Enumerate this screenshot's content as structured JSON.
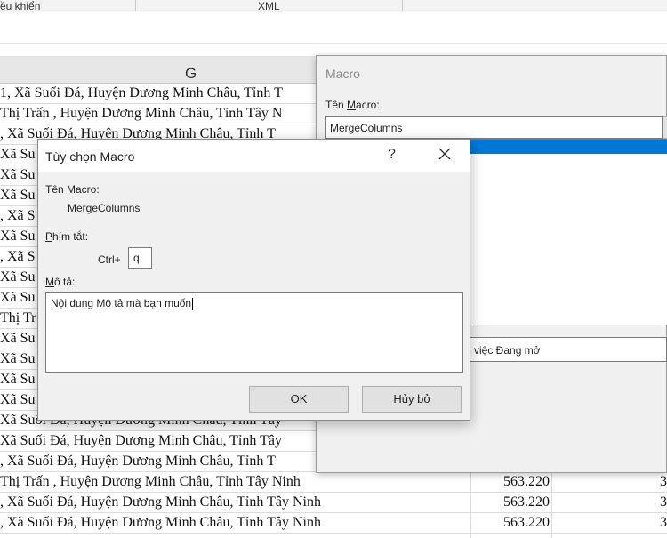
{
  "ribbon": {
    "group1": "ều khiển",
    "group2": "XML"
  },
  "sheet": {
    "column_header": "G",
    "rows": [
      {
        "address": "1, Xã Suối Đá, Huyện Dương Minh Châu, Tỉnh T",
        "num1": "",
        "num2": ""
      },
      {
        "address": "Thị Trấn , Huyện Dương Minh Châu, Tỉnh Tây N",
        "num1": "",
        "num2": ""
      },
      {
        "address": ", Xã Suối Đá, Huyện Dương Minh Châu, Tỉnh T",
        "num1": "",
        "num2": ""
      },
      {
        "address": "Xã Su",
        "num1": "",
        "num2": ""
      },
      {
        "address": "Xã Su",
        "num1": "",
        "num2": ""
      },
      {
        "address": "Xã Su",
        "num1": "",
        "num2": ""
      },
      {
        "address": ", Xã S",
        "num1": "",
        "num2": ""
      },
      {
        "address": "Xã Su",
        "num1": "",
        "num2": ""
      },
      {
        "address": ", Xã S",
        "num1": "",
        "num2": ""
      },
      {
        "address": "Xã Su",
        "num1": "",
        "num2": ""
      },
      {
        "address": "Xã Su",
        "num1": "",
        "num2": ""
      },
      {
        "address": "Thị Tr",
        "num1": "",
        "num2": ""
      },
      {
        "address": "Xã Su",
        "num1": "",
        "num2": ""
      },
      {
        "address": "Xã Su",
        "num1": "",
        "num2": ""
      },
      {
        "address": "Xã Su",
        "num1": "",
        "num2": ""
      },
      {
        "address": "Xã Su",
        "num1": "",
        "num2": ""
      },
      {
        "address": "Xã Suối Đá, Huyện Dương Minh Châu, Tỉnh Tây",
        "num1": "",
        "num2": ""
      },
      {
        "address": "Xã Suối Đá, Huyện Dương Minh Châu, Tỉnh Tây",
        "num1": "",
        "num2": ""
      },
      {
        "address": ", Xã Suối Đá, Huyện Dương Minh Châu, Tỉnh T",
        "num1": "",
        "num2": ""
      },
      {
        "address": "Thị Trấn , Huyện Dương Minh Châu, Tỉnh Tây Ninh",
        "num1": "563.220",
        "num2": "3"
      },
      {
        "address": ", Xã Suối Đá, Huyện Dương Minh Châu, Tỉnh Tây Ninh",
        "num1": "563.220",
        "num2": "3"
      },
      {
        "address": ", Xã Suối Đá, Huyện Dương Minh Châu, Tỉnh Tây Ninh",
        "num1": "563.220",
        "num2": "3"
      }
    ]
  },
  "macro_dialog": {
    "title": "Macro",
    "name_label_pre": "Tên ",
    "name_label_u": "M",
    "name_label_post": "acro:",
    "name_value": "MergeColumns",
    "macros_in_value": "việc Đang mở"
  },
  "options_dialog": {
    "title": "Tùy chọn Macro",
    "help_glyph": "?",
    "macro_name_label": "Tên Macro:",
    "macro_name_value": "MergeColumns",
    "shortcut_label_u": "P",
    "shortcut_label_post": "hím tắt:",
    "ctrl_label": "Ctrl+",
    "shortcut_key": "q",
    "desc_label_u": "M",
    "desc_label_post": "ô tả:",
    "description": "Nội dung Mô tả mà bạn muốn",
    "ok_label": "OK",
    "cancel_label": "Hủy bỏ"
  },
  "colors": {
    "selection": "#0078d7",
    "dialog_bg": "#f0f0f0",
    "button_bg": "#e1e1e1"
  }
}
